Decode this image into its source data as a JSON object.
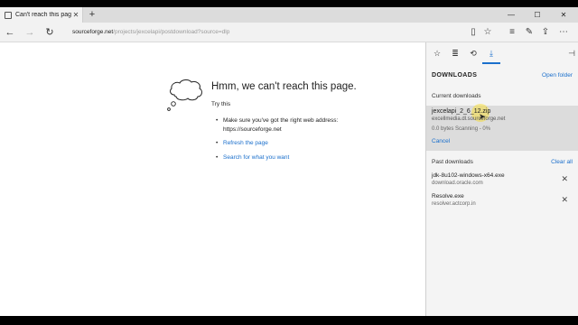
{
  "tab": {
    "title": "Can't reach this page",
    "close": "✕"
  },
  "newtab": "+",
  "window_controls": {
    "minimize": "—",
    "maximize": "☐",
    "close": "✕"
  },
  "nav": {
    "back": "←",
    "forward": "→",
    "refresh": "↻"
  },
  "address": {
    "host": "sourceforge.net",
    "path": "/projects/jexcelapi/postdownload?source=dlp"
  },
  "toolbar": {
    "reading_view": "▯",
    "favorite": "☆",
    "hub": "≡",
    "notes": "✎",
    "share": "⇪",
    "more": "⋯"
  },
  "error": {
    "title": "Hmm, we can't reach this page.",
    "try_this": "Try this",
    "bullets": [
      {
        "text": "Make sure you've got the right web address: https://sourceforge.net"
      },
      {
        "text": "Refresh the page"
      },
      {
        "text": "Search for what you want"
      }
    ]
  },
  "hub": {
    "tabs": {
      "favorites": "☆",
      "reading_list": "≣",
      "history": "⟲",
      "downloads": "⤓"
    },
    "pin": "⊣",
    "title": "DOWNLOADS",
    "open_folder": "Open folder",
    "current_label": "Current downloads",
    "current": {
      "file": "jexcelapi_2_6_12.zip",
      "host": "excellmedia.dl.sourceforge.net",
      "status": "0.0 bytes   Scanning - 0%",
      "cancel": "Cancel"
    },
    "past_label": "Past downloads",
    "clear_all": "Clear all",
    "past": [
      {
        "file": "jdk-8u102-windows-x64.exe",
        "host": "download.oracle.com",
        "remove": "✕"
      },
      {
        "file": "Resolve.exe",
        "host": "resolver.actcorp.in",
        "remove": "✕"
      }
    ]
  }
}
